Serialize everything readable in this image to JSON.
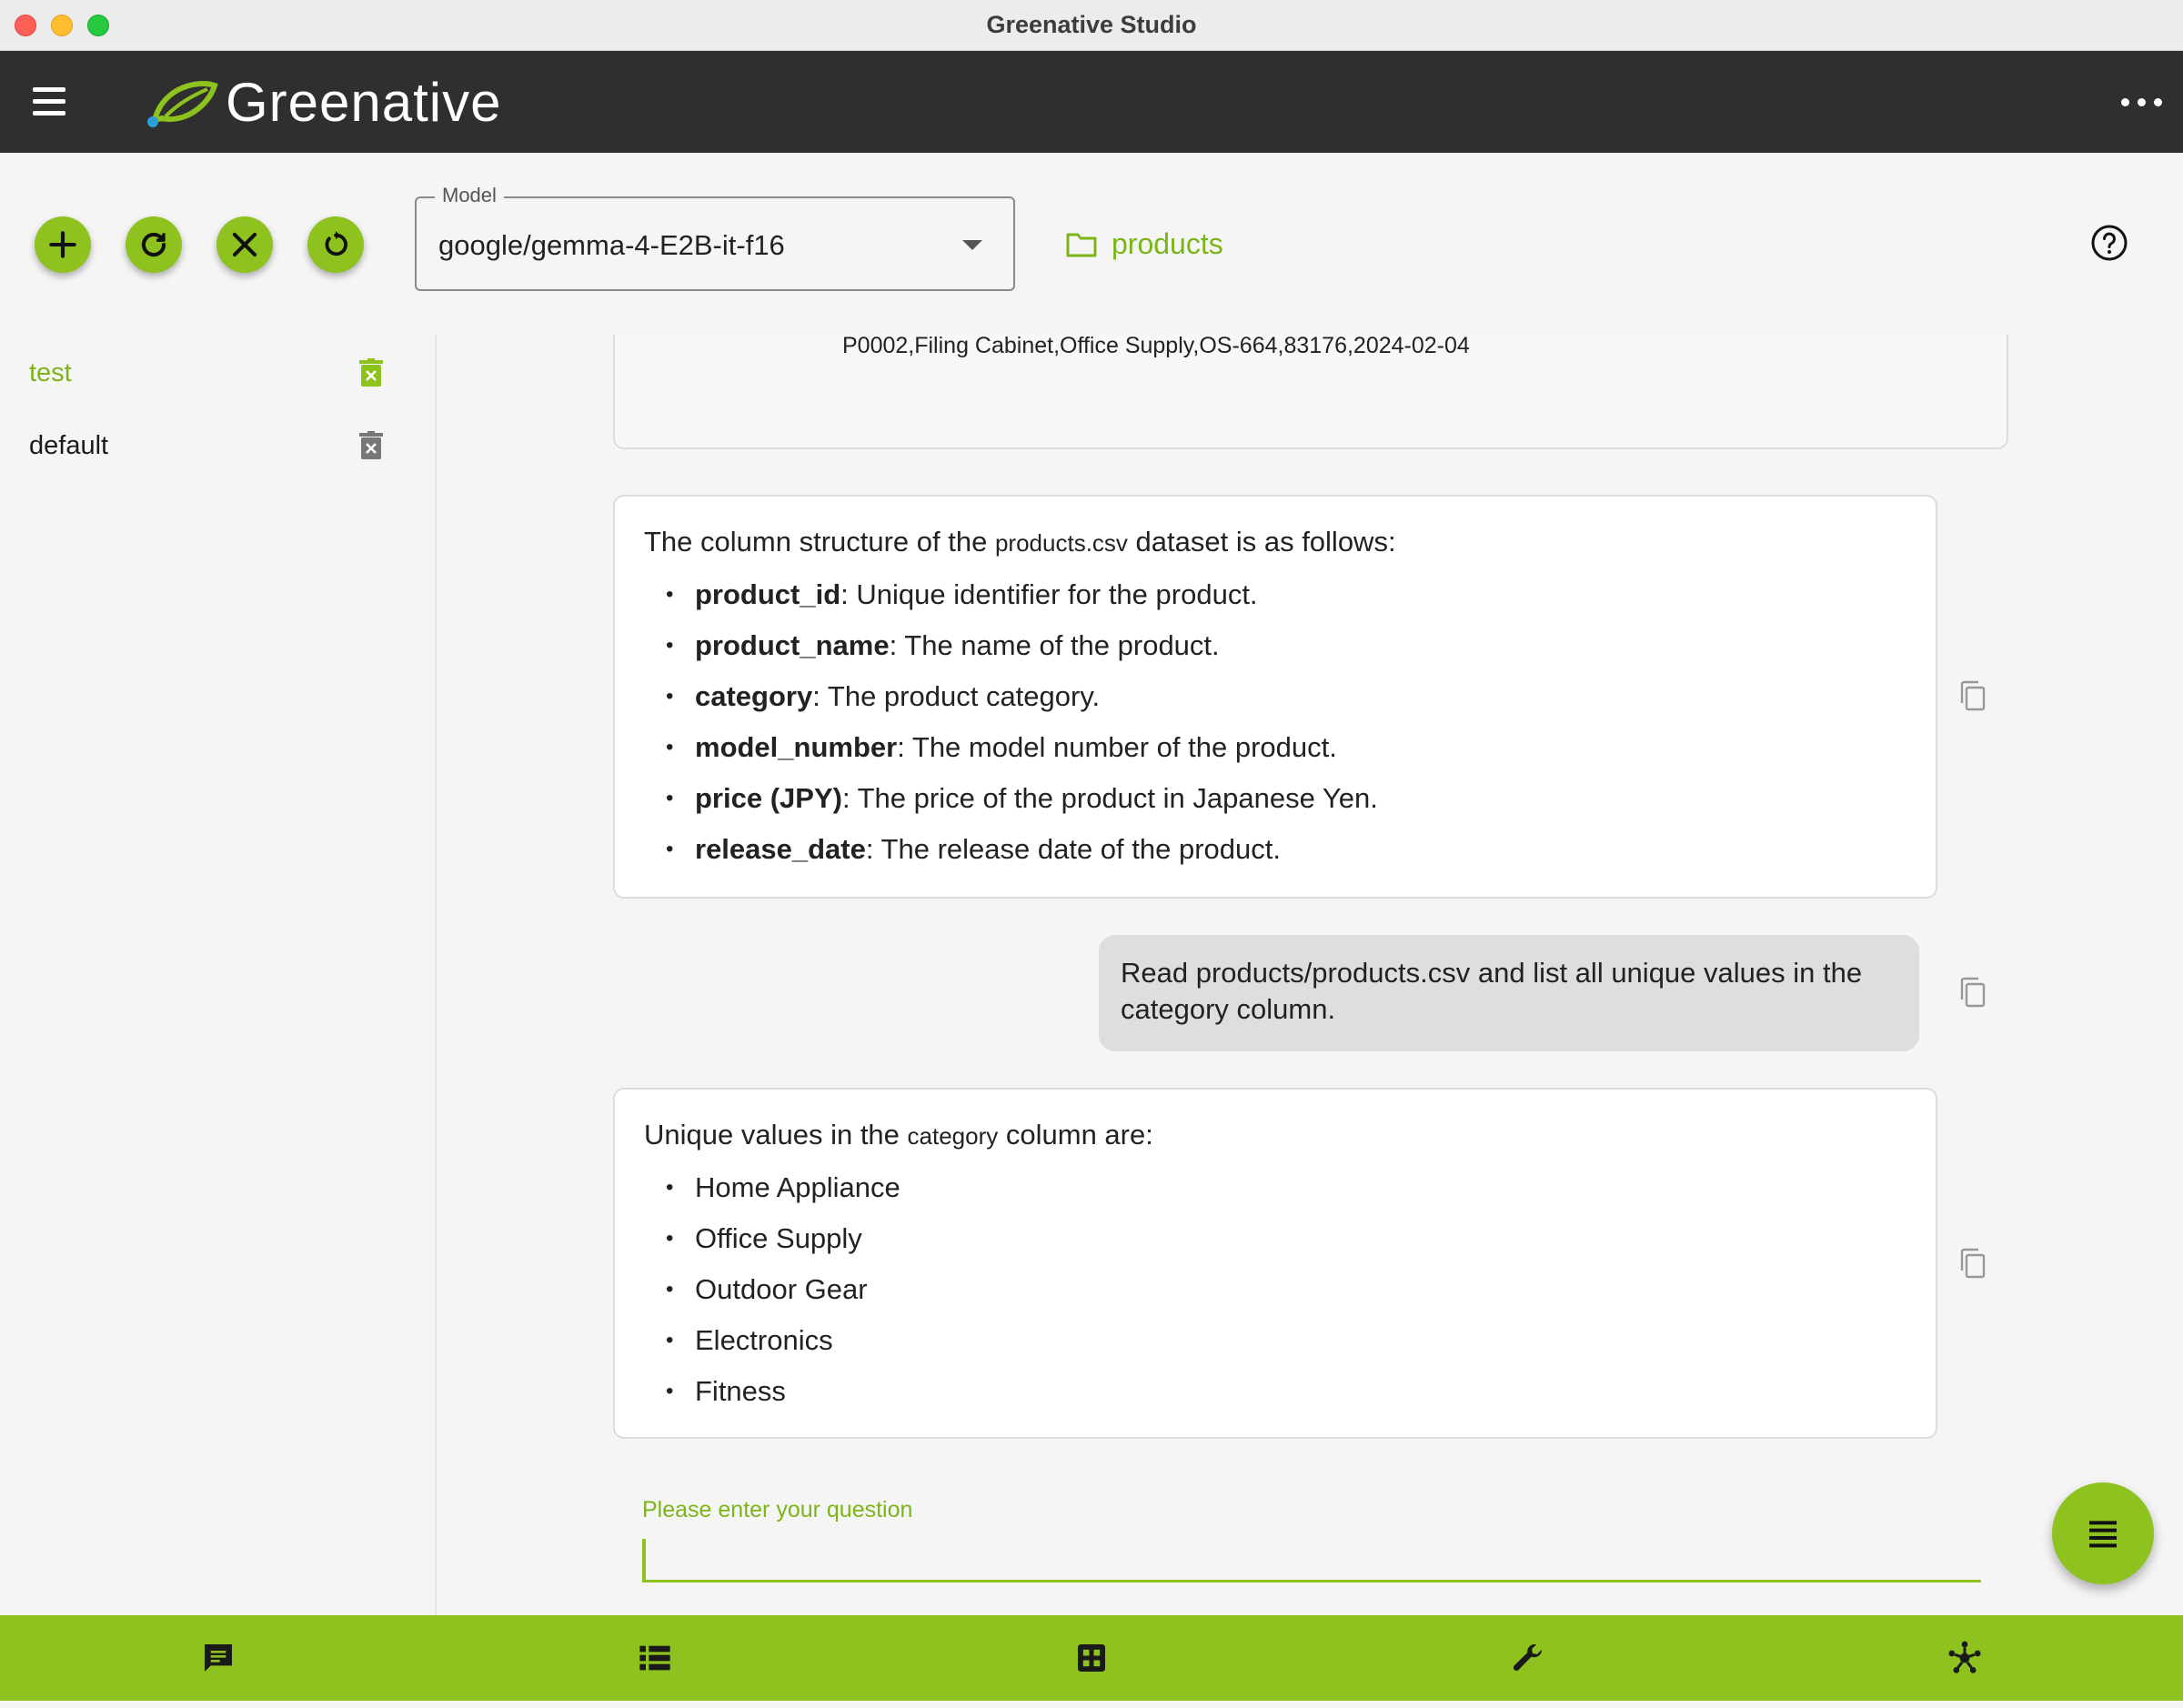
{
  "window": {
    "title": "Greenative Studio"
  },
  "appbar": {
    "logo_text": "Greenative",
    "menu_icon": "hamburger-icon",
    "more_icon": "more-horizontal-icon"
  },
  "toolbar": {
    "buttons": [
      {
        "name": "add-session-button",
        "icon": "plus-icon"
      },
      {
        "name": "refresh-button",
        "icon": "refresh-icon"
      },
      {
        "name": "clear-button",
        "icon": "close-icon"
      },
      {
        "name": "reset-button",
        "icon": "restore-icon"
      }
    ],
    "model": {
      "label": "Model",
      "value": "google/gemma-4-E2B-it-f16"
    },
    "folder": {
      "label": "products",
      "icon": "folder-icon"
    },
    "help_icon": "help-circle-icon"
  },
  "sidebar": {
    "sessions": [
      {
        "label": "test",
        "active": true
      },
      {
        "label": "default",
        "active": false
      }
    ]
  },
  "chat": {
    "previous_line": "P0002,Filing Cabinet,Office Supply,OS-664,83176,2024-02-04",
    "answer1": {
      "lead_before": "The column structure of the ",
      "lead_code": "products.csv",
      "lead_after": " dataset is as follows:",
      "items": [
        {
          "key": "product_id",
          "desc": ": Unique identifier for the product."
        },
        {
          "key": "product_name",
          "desc": ": The name of the product."
        },
        {
          "key": "category",
          "desc": ": The product category."
        },
        {
          "key": "model_number",
          "desc": ": The model number of the product."
        },
        {
          "key": "price (JPY)",
          "desc": ": The price of the product in Japanese Yen."
        },
        {
          "key": "release_date",
          "desc": ": The release date of the product."
        }
      ]
    },
    "user_message": "Read products/products.csv and list all unique values in the category column.",
    "answer2": {
      "lead_before": "Unique values in the ",
      "lead_code": "category",
      "lead_after": " column are:",
      "items": [
        "Home Appliance",
        "Office Supply",
        "Outdoor Gear",
        "Electronics",
        "Fitness"
      ]
    },
    "input": {
      "label": "Please enter your question",
      "value": ""
    }
  },
  "colors": {
    "accent": "#8dc21f",
    "appbar": "#2f2f2f",
    "accent_text": "#7cb518"
  },
  "bottom_nav": {
    "items": [
      "chat-icon",
      "list-icon",
      "dashboard-icon",
      "wrench-icon",
      "network-icon"
    ]
  }
}
